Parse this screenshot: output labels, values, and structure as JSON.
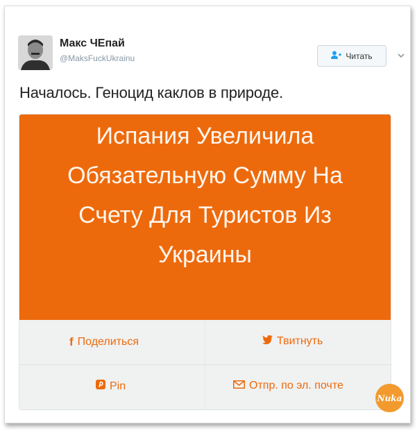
{
  "tweet": {
    "author_name": "Макс ЧЕпай",
    "author_handle": "@MaksFuckUkrainu",
    "follow_label": "Читать",
    "text": "Началось. Геноцид каклов в природе."
  },
  "card": {
    "headline_lines": [
      "Испания Увеличила",
      "Обязательную Сумму На",
      "Счету Для Туристов Из",
      "Украины"
    ],
    "share_buttons": {
      "facebook": "Поделиться",
      "twitter": "Твитнуть",
      "pinterest": "Pin",
      "email": "Отпр. по эл. почте"
    },
    "banner_color": "#ed6a0c"
  },
  "icons": {
    "follow": "add-user-icon",
    "more": "chevron-down-icon",
    "facebook": "facebook-icon",
    "twitter": "twitter-bird-icon",
    "pinterest": "pinterest-icon",
    "email": "envelope-icon"
  },
  "watermark": {
    "text": "Nuka"
  }
}
